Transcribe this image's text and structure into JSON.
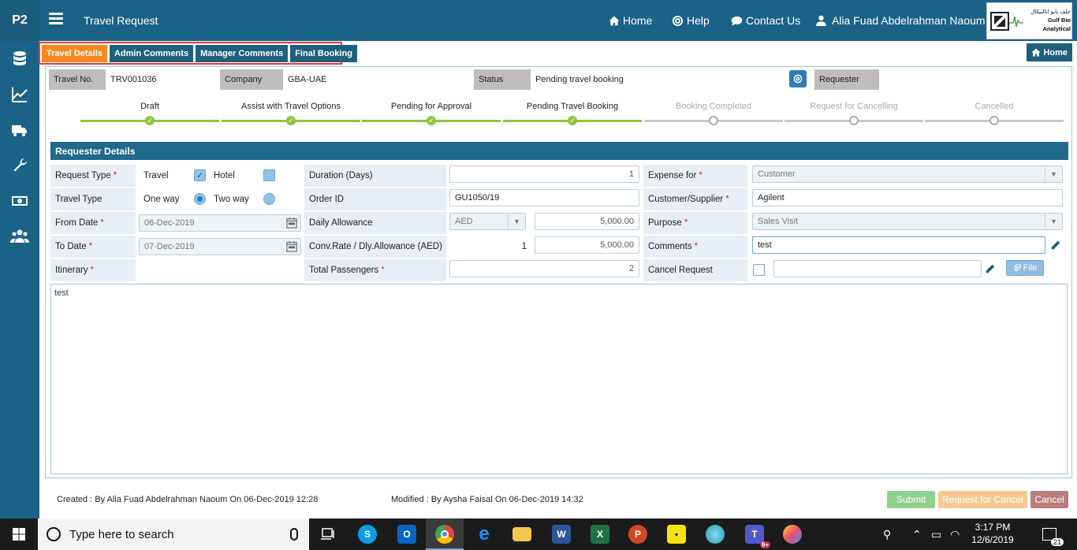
{
  "app": {
    "short_name": "P2",
    "title": "Travel Request"
  },
  "topnav": {
    "home": "Home",
    "help": "Help",
    "contact": "Contact Us",
    "user": "Alia Fuad Abdelrahman Naoum"
  },
  "logo": {
    "arabic": "جلف بايو انالتيكال",
    "english": "Gulf Bio Analytical"
  },
  "tabs": [
    {
      "label": "Travel Details",
      "active": true
    },
    {
      "label": "Admin Comments",
      "active": false
    },
    {
      "label": "Manager Comments",
      "active": false
    },
    {
      "label": "Final Booking",
      "active": false
    }
  ],
  "home_button": "Home",
  "info": {
    "travel_no_label": "Travel No.",
    "travel_no": "TRV001036",
    "company_label": "Company",
    "company": "GBA-UAE",
    "status_label": "Status",
    "status": "Pending travel booking",
    "requester_label": "Requester"
  },
  "steps": [
    {
      "label": "Draft",
      "done": true
    },
    {
      "label": "Assist with Travel Options",
      "done": true
    },
    {
      "label": "Pending for Approval",
      "done": true
    },
    {
      "label": "Pending Travel Booking",
      "done": true
    },
    {
      "label": "Booking Completed",
      "done": false
    },
    {
      "label": "Request for Cancelling",
      "done": false
    },
    {
      "label": "Cancelled",
      "done": false
    }
  ],
  "section_title": "Requester Details",
  "form": {
    "request_type_label": "Request Type",
    "travel_label": "Travel",
    "hotel_label": "Hotel",
    "travel_type_label": "Travel Type",
    "one_way_label": "One way",
    "two_way_label": "Two way",
    "from_date_label": "From Date",
    "from_date": "06-Dec-2019",
    "to_date_label": "To Date",
    "to_date": "07-Dec-2019",
    "itinerary_label": "Itinerary",
    "duration_label": "Duration (Days)",
    "duration": "1",
    "order_id_label": "Order ID",
    "order_id": "GU1050/19",
    "daily_allowance_label": "Daily Allowance",
    "currency": "AED",
    "daily_allowance": "5,000.00",
    "conv_rate_label": "Conv.Rate / Dly.Allowance (AED)",
    "conv_rate": "1",
    "conv_allowance": "5,000.00",
    "total_passengers_label": "Total Passengers",
    "total_passengers": "2",
    "expense_for_label": "Expense for",
    "expense_for": "Customer",
    "customer_label": "Customer/Supplier",
    "customer": "Agilent",
    "purpose_label": "Purpose",
    "purpose": "Sales Visit",
    "comments_label": "Comments",
    "comments": "test",
    "cancel_request_label": "Cancel Request",
    "file_button": "File",
    "itinerary_text": "test"
  },
  "footer": {
    "created": "Created : By Alia Fuad Abdelrahman Naoum On 06-Dec-2019 12:28",
    "modified": "Modified : By Aysha Faisal On 06-Dec-2019 14:32",
    "submit": "Submit",
    "request_cancel": "Request for Cancel",
    "cancel": "Cancel"
  },
  "colors": {
    "primary": "#1a6386",
    "active_tab": "#f5891f",
    "step_done": "#8cc63f",
    "submit": "#8fd08f",
    "request_cancel": "#f5c98f",
    "cancel": "#b97d7d"
  },
  "taskbar": {
    "search_placeholder": "Type here to search",
    "time": "3:17 PM",
    "date": "12/6/2019",
    "notification_count": "21",
    "teams_badge": "9+"
  }
}
